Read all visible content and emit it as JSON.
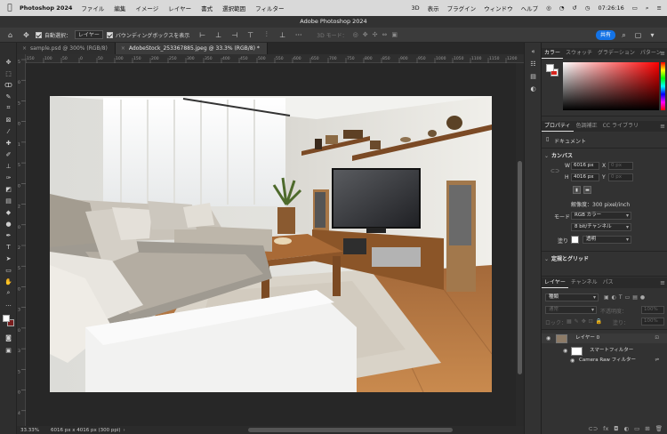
{
  "menubar": {
    "app_name": "Photoshop 2024",
    "items": [
      "ファイル",
      "編集",
      "イメージ",
      "レイヤー",
      "書式",
      "選択範囲",
      "フィルター",
      "3D",
      "表示",
      "プラグイン",
      "ウィンドウ",
      "ヘルプ"
    ],
    "clock": "07:26:16"
  },
  "window": {
    "title": "Adobe Photoshop 2024"
  },
  "options": {
    "auto_select_label": "自動選択：",
    "auto_select_value": "レイヤー",
    "bounding_box_label": "バウンディングボックスを表示",
    "mode_3d": "3D モード：",
    "share_label": "共有"
  },
  "tabs": [
    {
      "label": "sample.psd @ 300% (RGB/8)"
    },
    {
      "label": "AdobeStock_253367885.jpeg @ 33.3% (RGB/8) *"
    }
  ],
  "ruler_h": [
    "150",
    "100",
    "50",
    "0",
    "50",
    "100",
    "150",
    "200",
    "250",
    "300",
    "350",
    "400",
    "450",
    "500",
    "550",
    "600",
    "650",
    "700",
    "750",
    "800",
    "850",
    "900",
    "950",
    "1000",
    "1050",
    "1100",
    "1150",
    "1200"
  ],
  "ruler_v": [
    "5",
    "0",
    "5",
    "0",
    "1",
    "5",
    "0",
    "2",
    "0",
    "2",
    "5",
    "0",
    "3",
    "0",
    "3",
    "5",
    "0",
    "4"
  ],
  "status": {
    "zoom": "33.33%",
    "info": "6016 px x 4016 px (300 ppi)"
  },
  "color_panel": {
    "tabs": [
      "カラー",
      "スウォッチ",
      "グラデーション",
      "パターン"
    ]
  },
  "properties_panel": {
    "tabs": [
      "プロパティ",
      "色調補正",
      "CC ライブラリ"
    ],
    "doc_label": "ドキュメント",
    "canvas_header": "カンバス",
    "w_label": "W",
    "w_value": "6016 px",
    "h_label": "H",
    "h_value": "4016 px",
    "x_label": "X",
    "x_value": "0 px",
    "y_label": "Y",
    "y_value": "0 px",
    "resolution": "解像度：300 pixel/inch",
    "mode_label": "モード",
    "mode_value": "RGB カラー",
    "bit_value": "8 bit/チャンネル",
    "fill_label": "塗り",
    "fill_value": "透明",
    "rulers_header": "定規とグリッド"
  },
  "layers_panel": {
    "tabs": [
      "レイヤー",
      "チャンネル",
      "パス"
    ],
    "kind_value": "種類",
    "blend_value": "通常",
    "opacity_label": "不透明度：",
    "opacity_value": "100%",
    "lock_label": "ロック：",
    "fill_label": "塗り：",
    "fill_value": "100%",
    "layers": [
      {
        "name": "レイヤー 0"
      },
      {
        "name": "スマートフィルター"
      },
      {
        "name": "Camera Raw フィルター"
      }
    ]
  }
}
